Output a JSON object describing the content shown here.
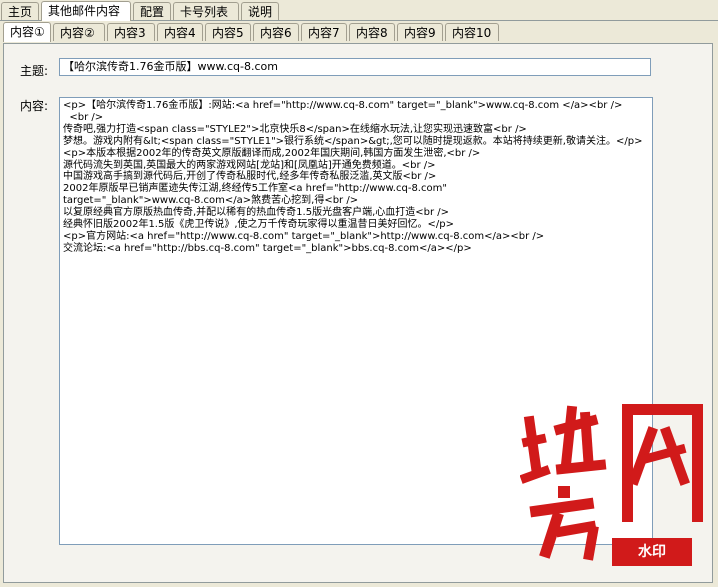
{
  "main_tabs": [
    "主页",
    "其他邮件内容",
    "配置",
    "卡号列表",
    "说明"
  ],
  "main_tabs_active": 1,
  "content_tabs": [
    "内容①",
    "内容②",
    "内容3",
    "内容4",
    "内容5",
    "内容6",
    "内容7",
    "内容8",
    "内容9",
    "内容10"
  ],
  "content_tabs_active": 0,
  "subject_label": "主题:",
  "subject_value": "【哈尔滨传奇1.76金币版】www.cq-8.com",
  "content_label": "内容:",
  "content_lines": [
    "<p>【哈尔滨传奇1.76金币版】:网站:<a href=\"http://www.cq-8.com\" target=\"_blank\">www.cq-8.com </a><br />",
    "  <br />",
    "传奇吧,强力打造<span class=\"STYLE2\">北京快乐8</span>在线缩水玩法,让您实现迅速致富<br />",
    "梦想。游戏内附有&lt;<span class=\"STYLE1\">银行系统</span>&gt;,您可以随时提现返款。本站将持续更新,敬请关注。</p>",
    "<p>本版本根据2002年的传奇英文原版翻译而成,2002年国庆期间,韩国方面发生泄密,<br />",
    "源代码流失到英国,英国最大的两家游戏网站[龙站]和[凤凰站]开通免费频道。<br />",
    "中国游戏高手搞到源代码后,开创了传奇私服时代,经多年传奇私服泛滥,英文版<br />",
    "2002年原版早已销声匿迹失传江湖,终经传5工作室<a href=\"http://www.cq-8.com\"",
    "target=\"_blank\">www.cq-8.com</a>煞费苦心挖到,得<br />",
    "以复原经典官方原版热血传奇,并配以稀有的热血传奇1.5版光盘客户端,心血打造<br />",
    "经典怀旧版2002年1.5版《虎卫传说》,使之万千传奇玩家得以重温昔日美好回忆。</p>",
    "<p>官方网站:<a href=\"http://www.cq-8.com\" target=\"_blank\">http://www.cq-8.com</a><br />",
    "交流论坛:<a href=\"http://bbs.cq-8.com\" target=\"_blank\">bbs.cq-8.com</a></p>"
  ],
  "watermark": {
    "text_large": "地方网",
    "badge": "水印",
    "color": "#d11a1a"
  }
}
